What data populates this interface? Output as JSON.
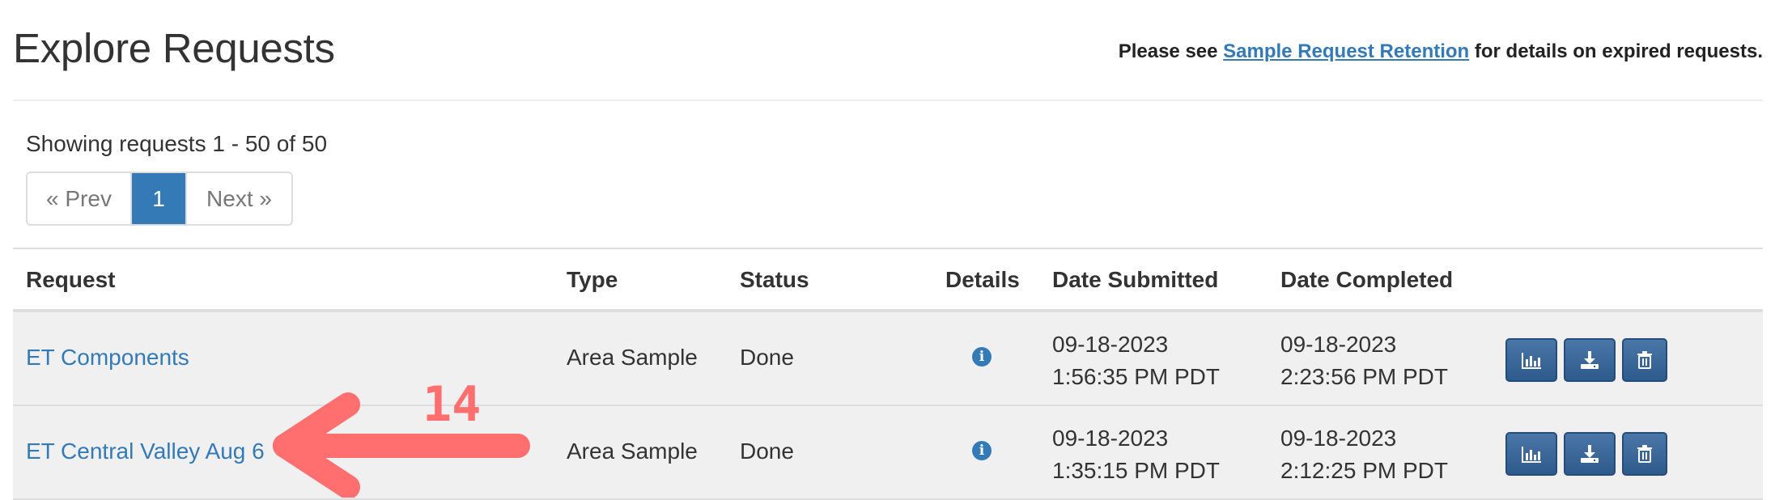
{
  "header": {
    "title": "Explore Requests",
    "note_prefix": "Please see",
    "note_link": "Sample Request Retention",
    "note_suffix": "for details on expired requests."
  },
  "summary": {
    "showing": "Showing requests 1 - 50 of 50"
  },
  "pagination": {
    "prev": "« Prev",
    "current": "1",
    "next": "Next »"
  },
  "table": {
    "columns": [
      "Request",
      "Type",
      "Status",
      "Details",
      "Date Submitted",
      "Date Completed"
    ],
    "rows": [
      {
        "request": "ET Components",
        "type": "Area Sample",
        "status": "Done",
        "submitted_date": "09-18-2023",
        "submitted_time": "1:56:35 PM PDT",
        "completed_date": "09-18-2023",
        "completed_time": "2:23:56 PM PDT"
      },
      {
        "request": "ET Central Valley Aug 6",
        "type": "Area Sample",
        "status": "Done",
        "submitted_date": "09-18-2023",
        "submitted_time": "1:35:15 PM PDT",
        "completed_date": "09-18-2023",
        "completed_time": "2:12:25 PM PDT"
      }
    ]
  },
  "icons": {
    "details": "info-icon",
    "chart": "bar-chart-icon",
    "download": "download-icon",
    "delete": "trash-icon"
  },
  "annotation": {
    "label": "14",
    "color": "#ff6f6f"
  },
  "colors": {
    "link": "#337ab7",
    "button": "#2e5a8c",
    "row_bg": "#f0f0f0"
  }
}
